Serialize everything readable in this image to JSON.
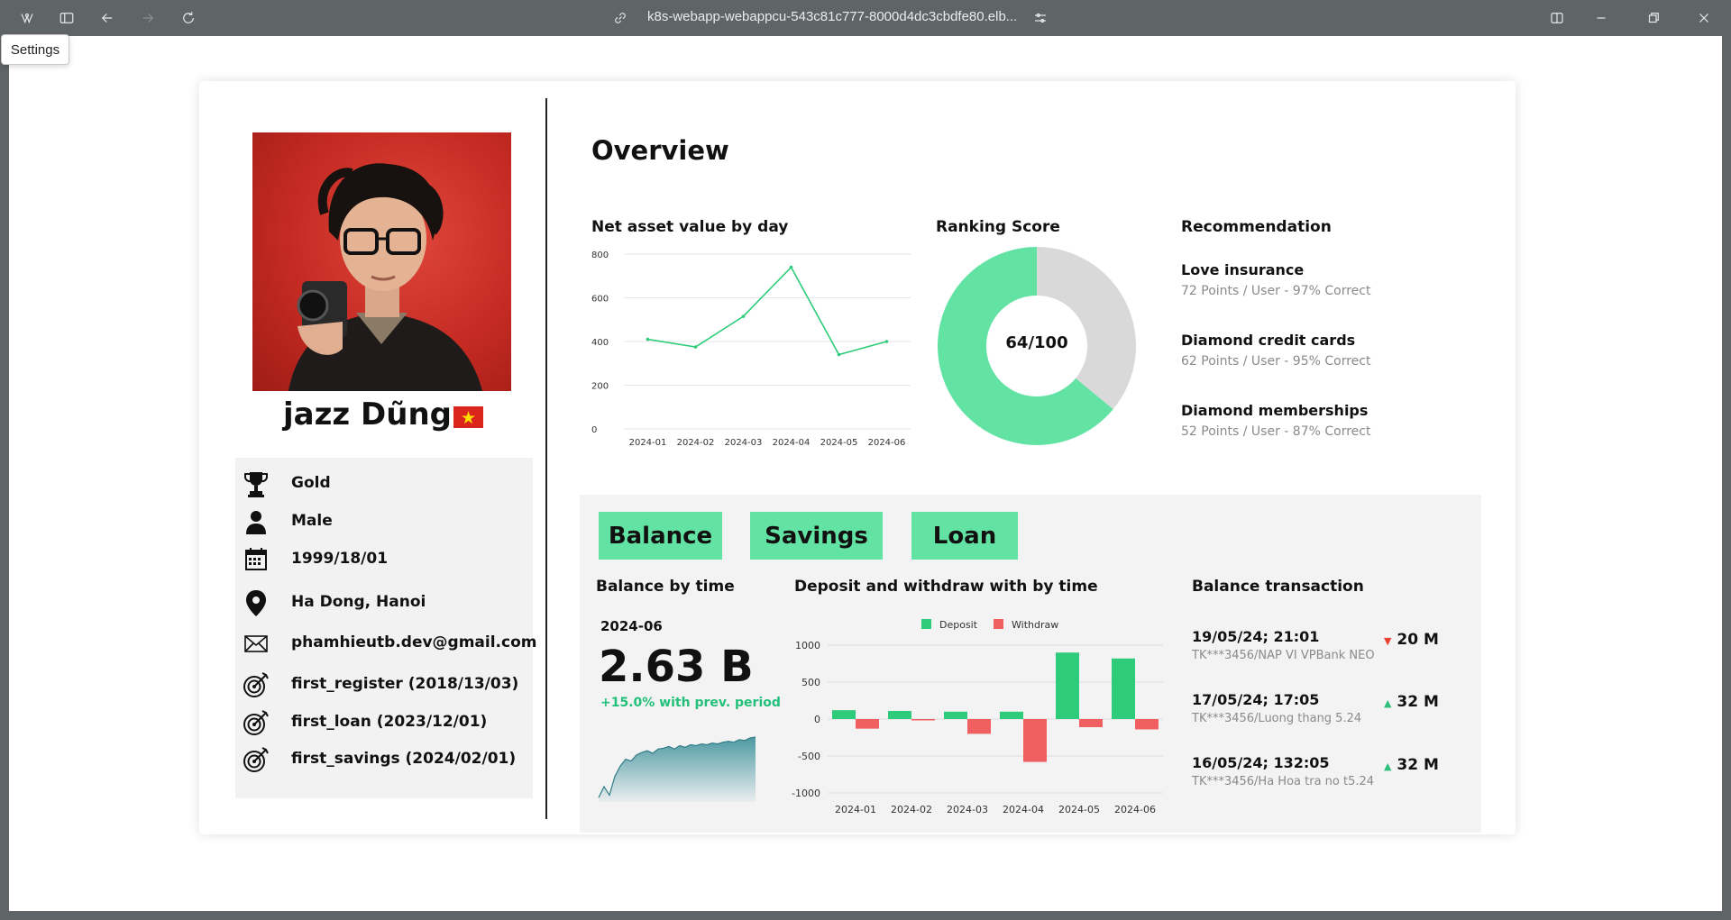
{
  "browser": {
    "url": "k8s-webapp-webappcu-543c81c777-8000d4dc3cbdfe80.elb...",
    "tooltip": "Settings"
  },
  "profile": {
    "name": "jazz Dũng",
    "info": [
      {
        "icon": "trophy-icon",
        "text": "Gold"
      },
      {
        "icon": "user-icon",
        "text": "Male"
      },
      {
        "icon": "calendar-icon",
        "text": "1999/18/01"
      },
      {
        "icon": "location-pin-icon",
        "text": "Ha Dong, Hanoi"
      },
      {
        "icon": "mail-icon",
        "text": "phamhieutb.dev@gmail.com"
      },
      {
        "icon": "target-icon",
        "text": "first_register (2018/13/03)"
      },
      {
        "icon": "target-icon",
        "text": "first_loan (2023/12/01)"
      },
      {
        "icon": "target-icon",
        "text": "first_savings (2024/02/01)"
      }
    ]
  },
  "overview": {
    "title": "Overview",
    "net_asset_title": "Net asset value by day",
    "ranking_title": "Ranking Score",
    "ranking_value": "64/100",
    "recommendation_title": "Recommendation",
    "recommendations": [
      {
        "name": "Love insurance",
        "detail": "72 Points / User - 97% Correct"
      },
      {
        "name": "Diamond credit cards",
        "detail": "62 Points / User - 95% Correct"
      },
      {
        "name": "Diamond memberships",
        "detail": "52 Points / User -  87% Correct"
      }
    ]
  },
  "tabs": [
    "Balance",
    "Savings",
    "Loan"
  ],
  "balance": {
    "title": "Balance by time",
    "period": "2024-06",
    "value": "2.63 B",
    "change": "+15.0% with prev. period"
  },
  "deposit_title": "Deposit and withdraw with by time",
  "transactions": {
    "title": "Balance transaction",
    "items": [
      {
        "date": "19/05/24; 21:01",
        "desc": "TK***3456/NAP VI VPBank NEO",
        "direction": "down",
        "arrow": "▼",
        "amount": "20 M"
      },
      {
        "date": "17/05/24; 17:05",
        "desc": "TK***3456/Luong thang 5.24",
        "direction": "up",
        "arrow": "▲",
        "amount": "32 M"
      },
      {
        "date": "16/05/24; 132:05",
        "desc": "TK***3456/Ha Hoa tra no  t5.24",
        "direction": "up",
        "arrow": "▲",
        "amount": "32 M"
      }
    ]
  },
  "colors": {
    "accent": "#62e3a4",
    "deposit": "#2ecc7a",
    "withdraw": "#f06060",
    "teal": "#3b8f9a"
  },
  "chart_data": [
    {
      "type": "line",
      "title": "Net asset value by day",
      "categories": [
        "2024-01",
        "2024-02",
        "2024-03",
        "2024-04",
        "2024-05",
        "2024-06"
      ],
      "values": [
        410,
        375,
        515,
        740,
        340,
        400
      ],
      "y_ticks": [
        "0",
        "200",
        "400",
        "600",
        "800"
      ],
      "ylim": [
        0,
        800
      ],
      "grid": true
    },
    {
      "type": "pie",
      "title": "Ranking Score",
      "slices": [
        {
          "label": "score",
          "value": 64
        },
        {
          "label": "rest",
          "value": 36
        }
      ],
      "center_label": "64/100"
    },
    {
      "type": "bar",
      "title": "Deposit and withdraw with by time",
      "categories": [
        "2024-01",
        "2024-02",
        "2024-03",
        "2024-04",
        "2024-05",
        "2024-06"
      ],
      "series": [
        {
          "name": "Deposit",
          "values": [
            120,
            110,
            100,
            100,
            900,
            820
          ]
        },
        {
          "name": "Withdraw",
          "values": [
            -130,
            -15,
            -200,
            -580,
            -110,
            -140
          ]
        }
      ],
      "y_ticks": [
        "1000",
        "500",
        "0",
        "-500",
        "-1000"
      ],
      "ylim": [
        -1000,
        1000
      ],
      "legend": "top"
    },
    {
      "type": "area",
      "title": "Balance by time",
      "values": [
        5,
        18,
        8,
        30,
        42,
        50,
        48,
        55,
        58,
        60,
        57,
        62,
        63,
        65,
        62,
        66,
        64,
        67,
        66,
        68,
        67,
        69,
        68,
        70,
        71,
        70,
        73,
        72,
        75,
        76
      ]
    }
  ]
}
